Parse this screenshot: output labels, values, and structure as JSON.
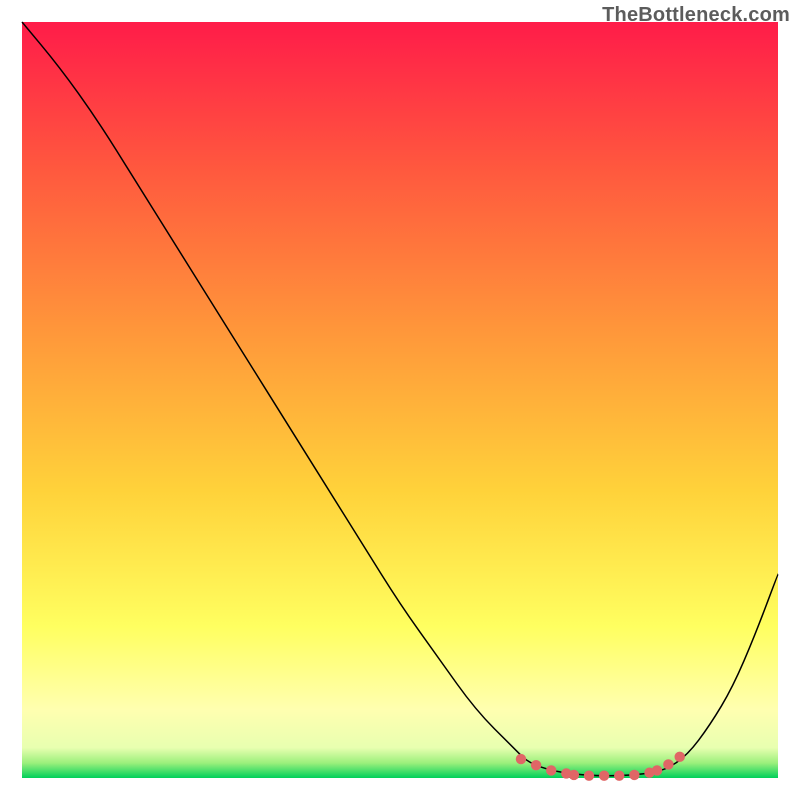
{
  "attribution": "TheBottleneck.com",
  "colors": {
    "gradient_top": "#ff1c49",
    "gradient_mid1": "#ff7a3b",
    "gradient_mid2": "#ffd93b",
    "gradient_mid3": "#ffff80",
    "gradient_bottom": "#00d05a",
    "curve": "#000000",
    "marker": "#e06666"
  },
  "chart_data": {
    "type": "line",
    "title": "",
    "xlabel": "",
    "ylabel": "",
    "xlim": [
      0,
      100
    ],
    "ylim": [
      0,
      100
    ],
    "x": [
      0,
      5,
      10,
      15,
      20,
      25,
      30,
      35,
      40,
      45,
      50,
      55,
      60,
      65,
      67,
      70,
      73,
      76,
      79,
      82,
      85,
      88,
      91,
      94,
      97,
      100
    ],
    "values": [
      100,
      94,
      87,
      79,
      71,
      63,
      55,
      47,
      39,
      31,
      23,
      16,
      9,
      4,
      2,
      1,
      0.5,
      0.3,
      0.3,
      0.5,
      1,
      3,
      7,
      12,
      19,
      27
    ],
    "series": [
      {
        "name": "bottleneck-curve",
        "x": [
          0,
          5,
          10,
          15,
          20,
          25,
          30,
          35,
          40,
          45,
          50,
          55,
          60,
          65,
          67,
          70,
          73,
          76,
          79,
          82,
          85,
          88,
          91,
          94,
          97,
          100
        ],
        "y": [
          100,
          94,
          87,
          79,
          71,
          63,
          55,
          47,
          39,
          31,
          23,
          16,
          9,
          4,
          2,
          1,
          0.5,
          0.3,
          0.3,
          0.5,
          1,
          3,
          7,
          12,
          19,
          27
        ]
      }
    ],
    "markers": {
      "name": "optimal-range-markers",
      "x": [
        66,
        68,
        70,
        72,
        73,
        75,
        77,
        79,
        81,
        83,
        84,
        85.5,
        87
      ],
      "y": [
        2.5,
        1.7,
        1,
        0.6,
        0.4,
        0.3,
        0.3,
        0.3,
        0.4,
        0.7,
        1,
        1.8,
        2.8
      ]
    }
  }
}
